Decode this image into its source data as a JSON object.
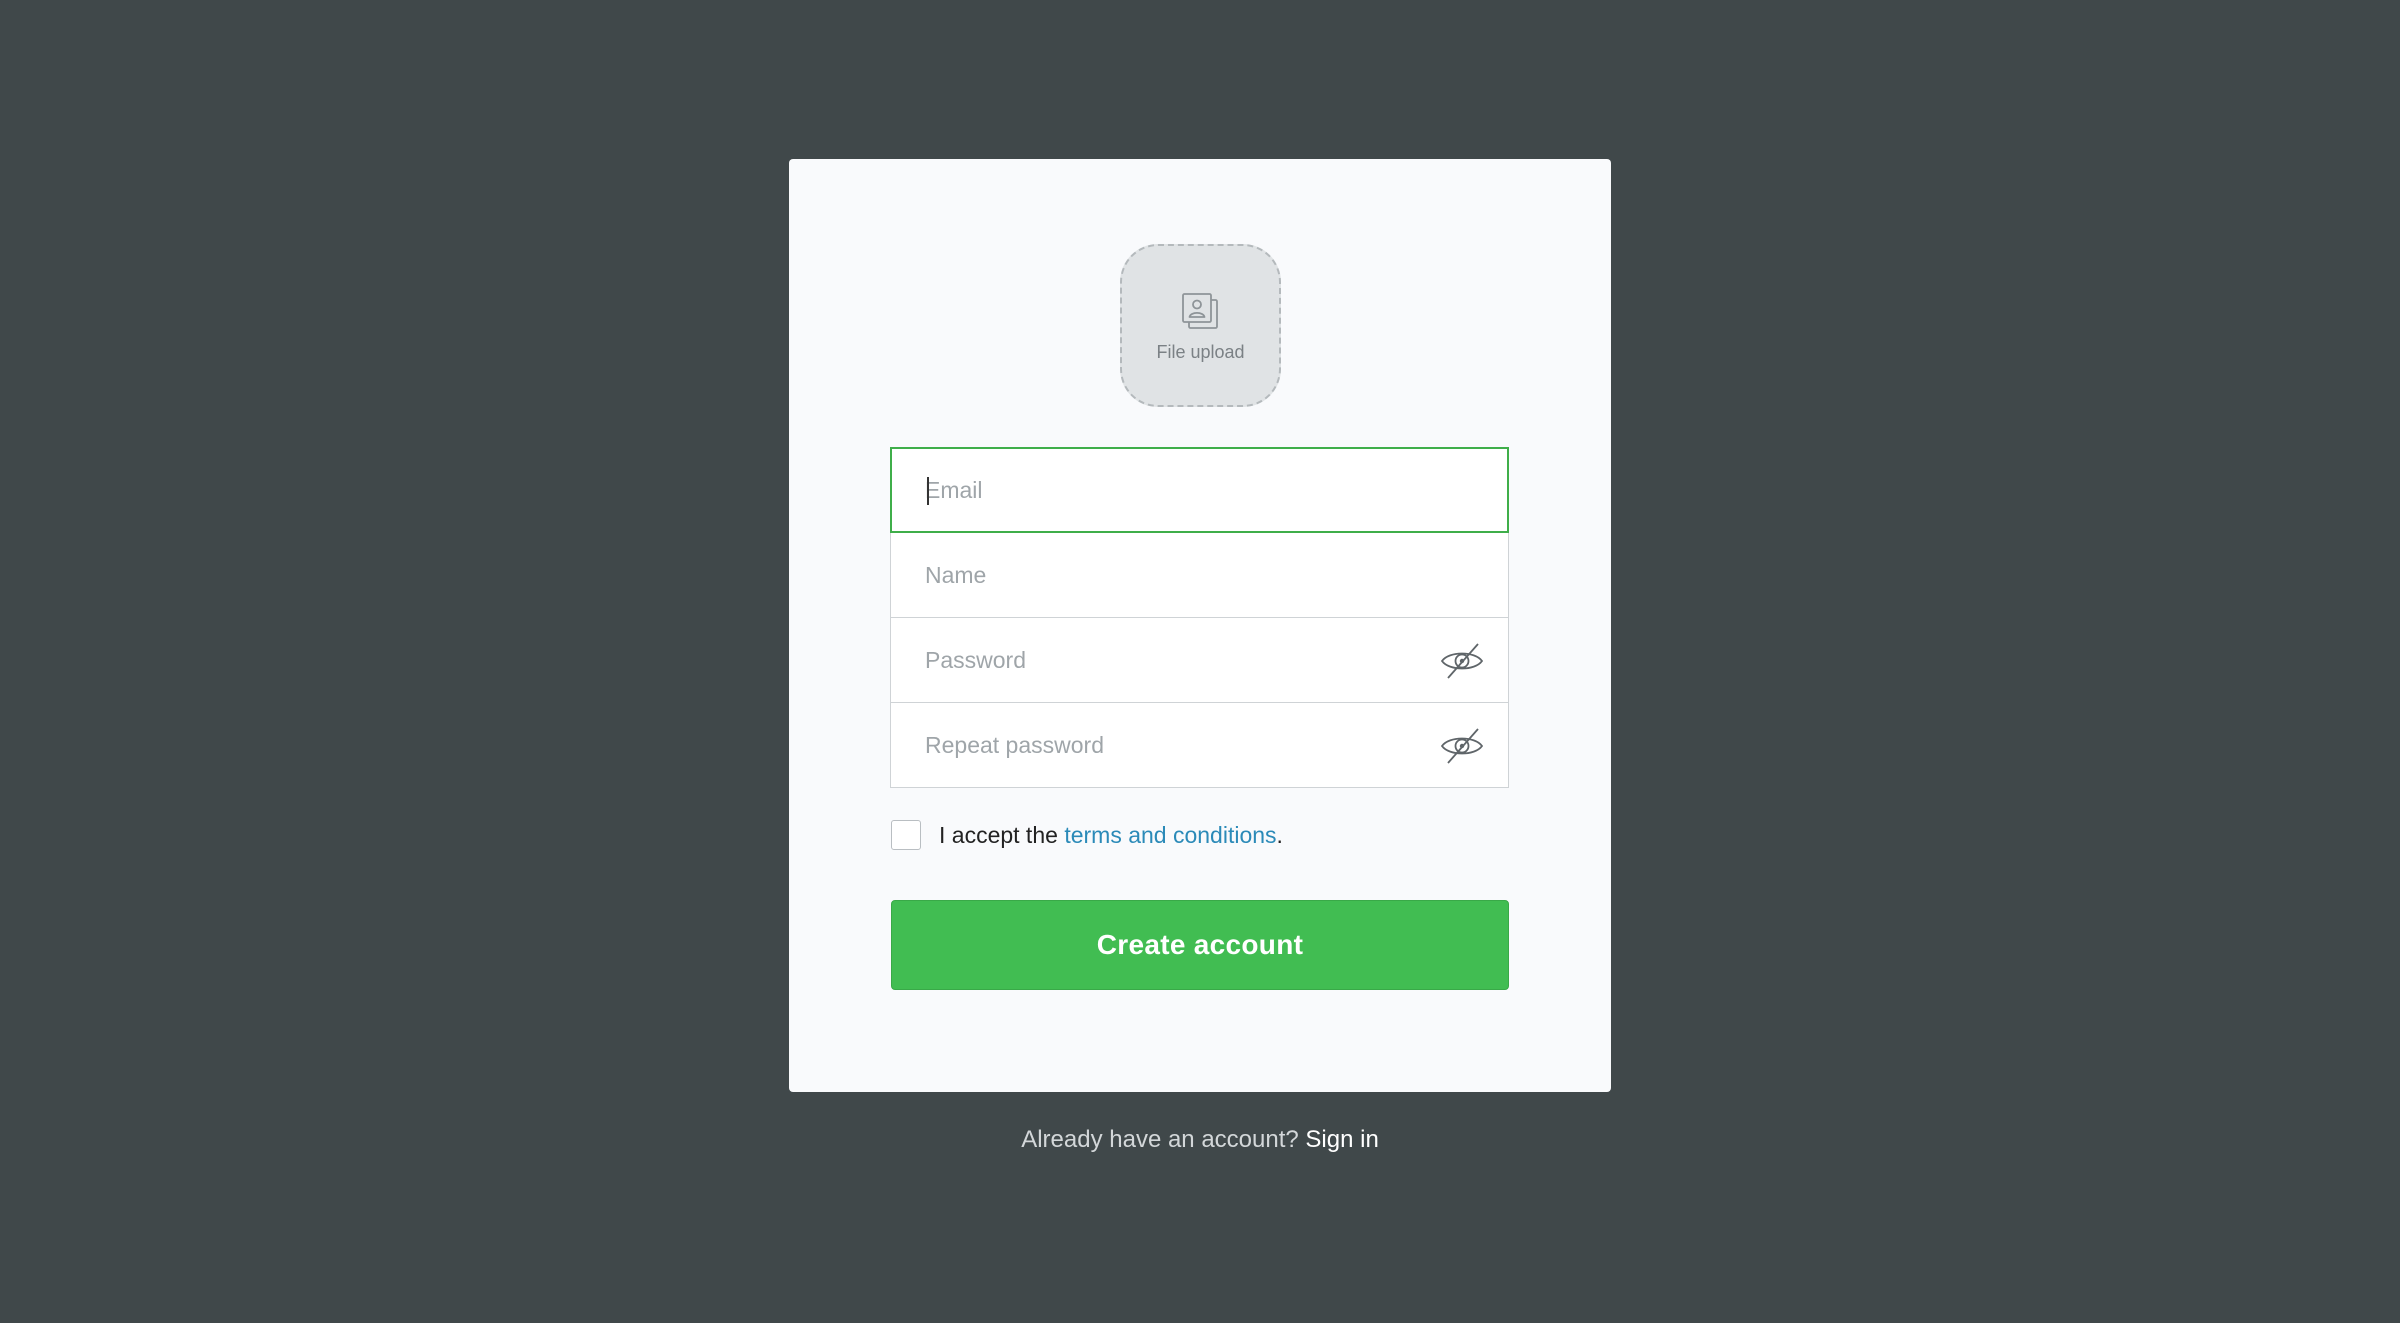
{
  "upload": {
    "label": "File upload",
    "icon": "portrait-stack-icon"
  },
  "form": {
    "email_placeholder": "Email",
    "name_placeholder": "Name",
    "password_placeholder": "Password",
    "repeat_password_placeholder": "Repeat password",
    "visibility_icon": "eye-slash-icon"
  },
  "terms": {
    "prefix": "I accept the ",
    "link": "terms and conditions",
    "suffix": "."
  },
  "submit": {
    "label": "Create account"
  },
  "footer": {
    "prompt": "Already have an account? ",
    "link": "Sign in"
  },
  "colors": {
    "background": "#40484a",
    "card": "#f9fafc",
    "accent": "#41bd52",
    "focus_border": "#3fae4a",
    "link": "#2b8ab8"
  }
}
